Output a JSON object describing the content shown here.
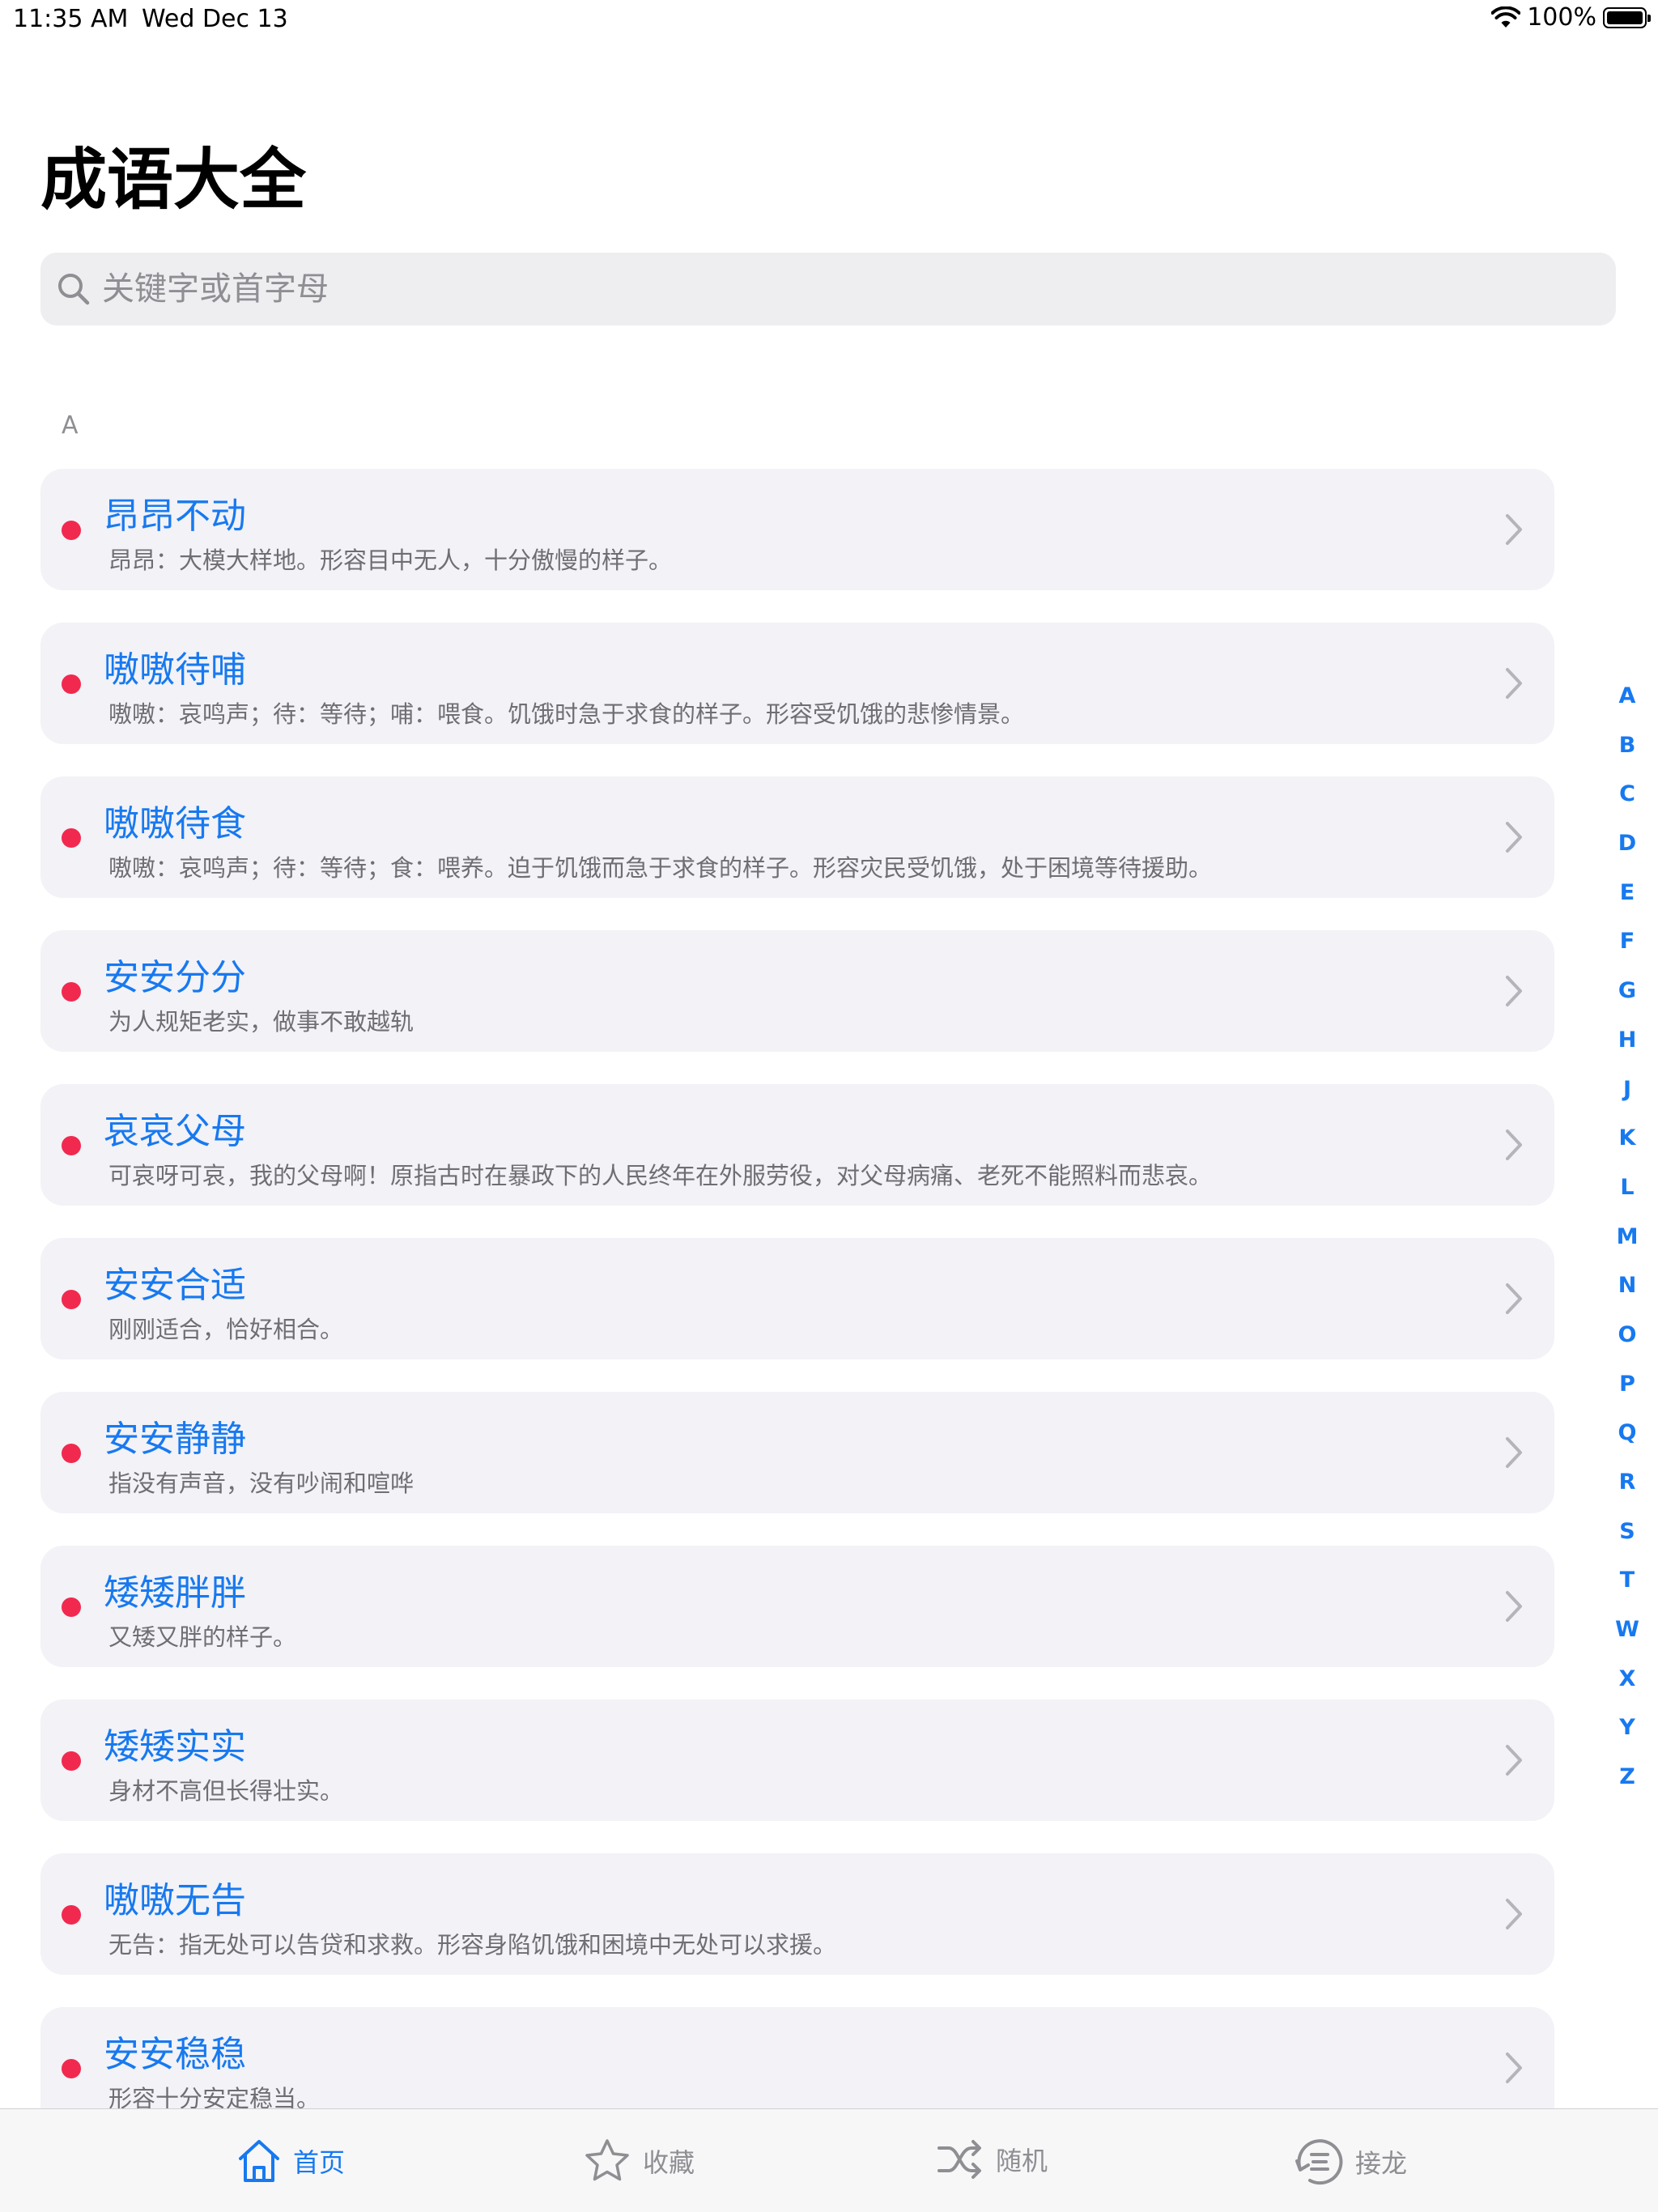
{
  "status_bar": {
    "time": "11:35 AM",
    "date": "Wed Dec 13",
    "battery": "100%"
  },
  "title": "成语大全",
  "search": {
    "placeholder": "关键字或首字母",
    "value": ""
  },
  "section": "A",
  "items": [
    {
      "title": "昂昂不动",
      "subtitle": "昂昂：大模大样地。形容目中无人，十分傲慢的样子。"
    },
    {
      "title": "嗷嗷待哺",
      "subtitle": "嗷嗷：哀鸣声；待：等待；哺：喂食。饥饿时急于求食的样子。形容受饥饿的悲惨情景。"
    },
    {
      "title": "嗷嗷待食",
      "subtitle": "嗷嗷：哀鸣声；待：等待；食：喂养。迫于饥饿而急于求食的样子。形容灾民受饥饿，处于困境等待援助。"
    },
    {
      "title": "安安分分",
      "subtitle": "为人规矩老实，做事不敢越轨"
    },
    {
      "title": "哀哀父母",
      "subtitle": "可哀呀可哀，我的父母啊！原指古时在暴政下的人民终年在外服劳役，对父母病痛、老死不能照料而悲哀。"
    },
    {
      "title": "安安合适",
      "subtitle": "刚刚适合，恰好相合。"
    },
    {
      "title": "安安静静",
      "subtitle": "指没有声音，没有吵闹和喧哗"
    },
    {
      "title": "矮矮胖胖",
      "subtitle": "又矮又胖的样子。"
    },
    {
      "title": "矮矮实实",
      "subtitle": "身材不高但长得壮实。"
    },
    {
      "title": "嗷嗷无告",
      "subtitle": "无告：指无处可以告贷和求救。形容身陷饥饿和困境中无处可以求援。"
    },
    {
      "title": "安安稳稳",
      "subtitle": "形容十分安定稳当。"
    }
  ],
  "alphabet_index": [
    "A",
    "B",
    "C",
    "D",
    "E",
    "F",
    "G",
    "H",
    "J",
    "K",
    "L",
    "M",
    "N",
    "O",
    "P",
    "Q",
    "R",
    "S",
    "T",
    "W",
    "X",
    "Y",
    "Z"
  ],
  "tabs": [
    {
      "label": "首页",
      "icon": "home-icon",
      "active": true
    },
    {
      "label": "收藏",
      "icon": "star-icon",
      "active": false
    },
    {
      "label": "随机",
      "icon": "shuffle-icon",
      "active": false
    },
    {
      "label": "接龙",
      "icon": "list-icon",
      "active": false
    }
  ],
  "colors": {
    "accent": "#1779f0",
    "dot": "#f2294f",
    "row_background": "#f2f2f7",
    "inactive": "#8e8e93"
  }
}
